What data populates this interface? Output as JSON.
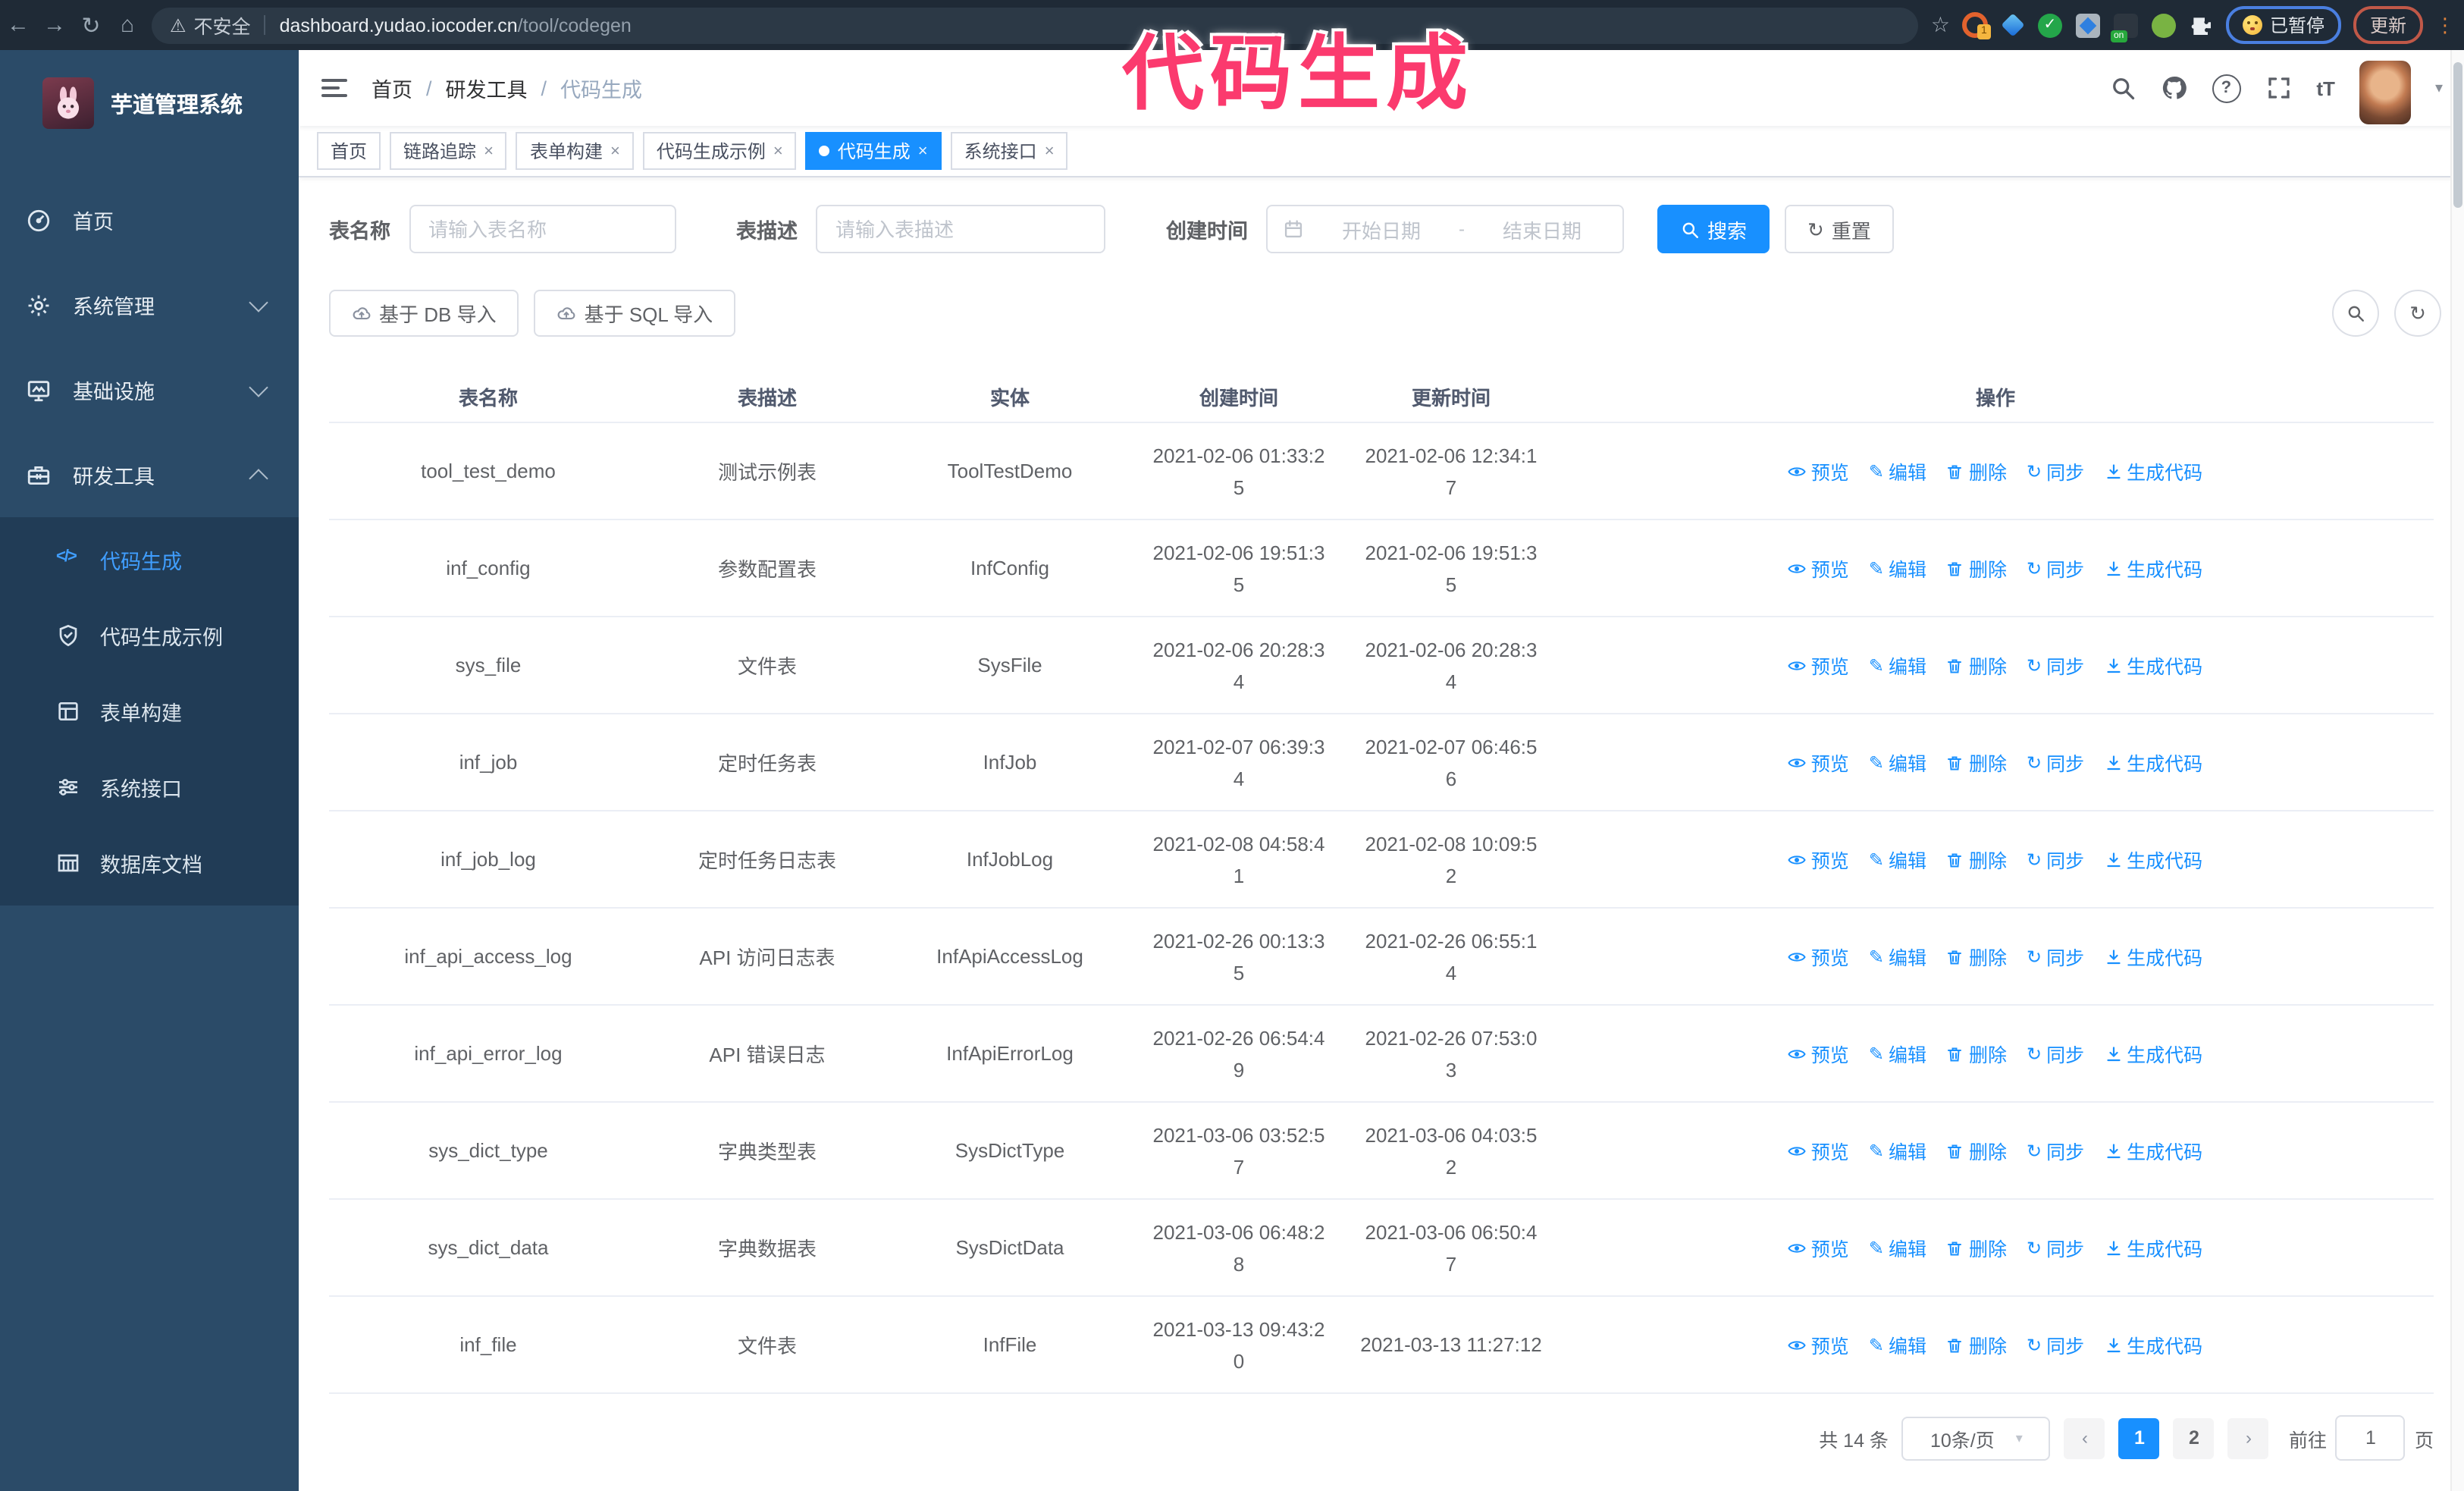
{
  "colors": {
    "primary": "#1890ff",
    "sidebar_bg": "#2b4b68",
    "submenu_bg": "#213c56",
    "annotation_pink": "#fb3a6e",
    "chrome_bg": "#1f2a36"
  },
  "icons": {
    "back": "←",
    "forward": "→",
    "reload": "↻",
    "home": "⌂",
    "warning": "⚠",
    "star": "☆",
    "more": "⋮",
    "gear": "⚙",
    "edit": "✎",
    "sync": "↻",
    "reset": "↻",
    "font_size": "tT",
    "code": "</>",
    "question": "?",
    "caret": "▾",
    "badge_one": "1",
    "badge_on": "on"
  },
  "browser": {
    "security_label": "不安全",
    "url_host": "dashboard.yudao.iocoder.cn",
    "url_path": "/tool/codegen",
    "paused_badge": "已暂停",
    "update_button": "更新"
  },
  "overlay": {
    "title": "代码生成"
  },
  "sidebar": {
    "app_title": "芋道管理系统",
    "items": [
      {
        "label": "首页"
      },
      {
        "label": "系统管理"
      },
      {
        "label": "基础设施"
      },
      {
        "label": "研发工具"
      }
    ],
    "submenu": [
      {
        "label": "代码生成"
      },
      {
        "label": "代码生成示例"
      },
      {
        "label": "表单构建"
      },
      {
        "label": "系统接口"
      },
      {
        "label": "数据库文档"
      }
    ]
  },
  "header": {
    "breadcrumb": [
      "首页",
      "研发工具",
      "代码生成"
    ]
  },
  "tabs": [
    {
      "label": "首页"
    },
    {
      "label": "链路追踪"
    },
    {
      "label": "表单构建"
    },
    {
      "label": "代码生成示例"
    },
    {
      "label": "代码生成"
    },
    {
      "label": "系统接口"
    }
  ],
  "filters": {
    "name_label": "表名称",
    "name_placeholder": "请输入表名称",
    "desc_label": "表描述",
    "desc_placeholder": "请输入表描述",
    "time_label": "创建时间",
    "start_placeholder": "开始日期",
    "range_separator": "-",
    "end_placeholder": "结束日期",
    "search_button": "搜索",
    "reset_button": "重置"
  },
  "toolbar": {
    "import_db": "基于 DB 导入",
    "import_sql": "基于 SQL 导入"
  },
  "table": {
    "columns": [
      "表名称",
      "表描述",
      "实体",
      "创建时间",
      "更新时间",
      "操作"
    ],
    "actions": [
      "预览",
      "编辑",
      "删除",
      "同步",
      "生成代码"
    ],
    "rows": [
      {
        "name": "tool_test_demo",
        "desc": "测试示例表",
        "entity": "ToolTestDemo",
        "created": "2021-02-06 01:33:25",
        "updated": "2021-02-06 12:34:17"
      },
      {
        "name": "inf_config",
        "desc": "参数配置表",
        "entity": "InfConfig",
        "created": "2021-02-06 19:51:35",
        "updated": "2021-02-06 19:51:35"
      },
      {
        "name": "sys_file",
        "desc": "文件表",
        "entity": "SysFile",
        "created": "2021-02-06 20:28:34",
        "updated": "2021-02-06 20:28:34"
      },
      {
        "name": "inf_job",
        "desc": "定时任务表",
        "entity": "InfJob",
        "created": "2021-02-07 06:39:34",
        "updated": "2021-02-07 06:46:56"
      },
      {
        "name": "inf_job_log",
        "desc": "定时任务日志表",
        "entity": "InfJobLog",
        "created": "2021-02-08 04:58:41",
        "updated": "2021-02-08 10:09:52"
      },
      {
        "name": "inf_api_access_log",
        "desc": "API 访问日志表",
        "entity": "InfApiAccessLog",
        "created": "2021-02-26 00:13:35",
        "updated": "2021-02-26 06:55:14"
      },
      {
        "name": "inf_api_error_log",
        "desc": "API 错误日志",
        "entity": "InfApiErrorLog",
        "created": "2021-02-26 06:54:49",
        "updated": "2021-02-26 07:53:03"
      },
      {
        "name": "sys_dict_type",
        "desc": "字典类型表",
        "entity": "SysDictType",
        "created": "2021-03-06 03:52:57",
        "updated": "2021-03-06 04:03:52"
      },
      {
        "name": "sys_dict_data",
        "desc": "字典数据表",
        "entity": "SysDictData",
        "created": "2021-03-06 06:48:28",
        "updated": "2021-03-06 06:50:47"
      },
      {
        "name": "inf_file",
        "desc": "文件表",
        "entity": "InfFile",
        "created": "2021-03-13 09:43:20",
        "updated": "2021-03-13 11:27:12"
      }
    ]
  },
  "pagination": {
    "total_label": "共 14 条",
    "page_size": "10条/页",
    "pages": [
      "1",
      "2"
    ],
    "goto_label": "前往",
    "goto_value": "1",
    "goto_suffix": "页"
  }
}
